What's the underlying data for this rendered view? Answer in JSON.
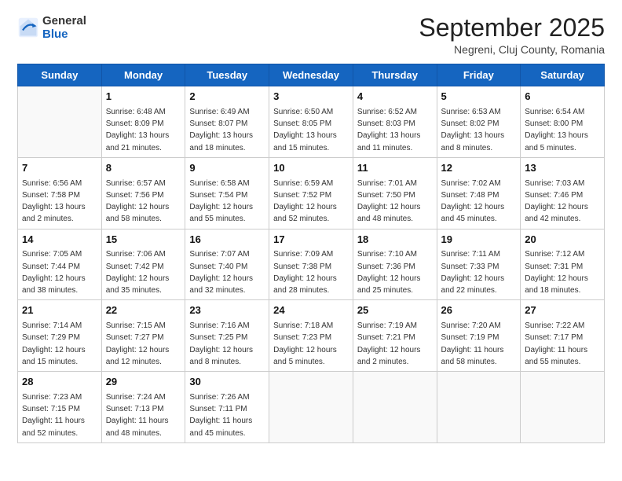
{
  "header": {
    "logo_general": "General",
    "logo_blue": "Blue",
    "month": "September 2025",
    "location": "Negreni, Cluj County, Romania"
  },
  "weekdays": [
    "Sunday",
    "Monday",
    "Tuesday",
    "Wednesday",
    "Thursday",
    "Friday",
    "Saturday"
  ],
  "weeks": [
    [
      {
        "day": "",
        "text": ""
      },
      {
        "day": "1",
        "text": "Sunrise: 6:48 AM\nSunset: 8:09 PM\nDaylight: 13 hours\nand 21 minutes."
      },
      {
        "day": "2",
        "text": "Sunrise: 6:49 AM\nSunset: 8:07 PM\nDaylight: 13 hours\nand 18 minutes."
      },
      {
        "day": "3",
        "text": "Sunrise: 6:50 AM\nSunset: 8:05 PM\nDaylight: 13 hours\nand 15 minutes."
      },
      {
        "day": "4",
        "text": "Sunrise: 6:52 AM\nSunset: 8:03 PM\nDaylight: 13 hours\nand 11 minutes."
      },
      {
        "day": "5",
        "text": "Sunrise: 6:53 AM\nSunset: 8:02 PM\nDaylight: 13 hours\nand 8 minutes."
      },
      {
        "day": "6",
        "text": "Sunrise: 6:54 AM\nSunset: 8:00 PM\nDaylight: 13 hours\nand 5 minutes."
      }
    ],
    [
      {
        "day": "7",
        "text": "Sunrise: 6:56 AM\nSunset: 7:58 PM\nDaylight: 13 hours\nand 2 minutes."
      },
      {
        "day": "8",
        "text": "Sunrise: 6:57 AM\nSunset: 7:56 PM\nDaylight: 12 hours\nand 58 minutes."
      },
      {
        "day": "9",
        "text": "Sunrise: 6:58 AM\nSunset: 7:54 PM\nDaylight: 12 hours\nand 55 minutes."
      },
      {
        "day": "10",
        "text": "Sunrise: 6:59 AM\nSunset: 7:52 PM\nDaylight: 12 hours\nand 52 minutes."
      },
      {
        "day": "11",
        "text": "Sunrise: 7:01 AM\nSunset: 7:50 PM\nDaylight: 12 hours\nand 48 minutes."
      },
      {
        "day": "12",
        "text": "Sunrise: 7:02 AM\nSunset: 7:48 PM\nDaylight: 12 hours\nand 45 minutes."
      },
      {
        "day": "13",
        "text": "Sunrise: 7:03 AM\nSunset: 7:46 PM\nDaylight: 12 hours\nand 42 minutes."
      }
    ],
    [
      {
        "day": "14",
        "text": "Sunrise: 7:05 AM\nSunset: 7:44 PM\nDaylight: 12 hours\nand 38 minutes."
      },
      {
        "day": "15",
        "text": "Sunrise: 7:06 AM\nSunset: 7:42 PM\nDaylight: 12 hours\nand 35 minutes."
      },
      {
        "day": "16",
        "text": "Sunrise: 7:07 AM\nSunset: 7:40 PM\nDaylight: 12 hours\nand 32 minutes."
      },
      {
        "day": "17",
        "text": "Sunrise: 7:09 AM\nSunset: 7:38 PM\nDaylight: 12 hours\nand 28 minutes."
      },
      {
        "day": "18",
        "text": "Sunrise: 7:10 AM\nSunset: 7:36 PM\nDaylight: 12 hours\nand 25 minutes."
      },
      {
        "day": "19",
        "text": "Sunrise: 7:11 AM\nSunset: 7:33 PM\nDaylight: 12 hours\nand 22 minutes."
      },
      {
        "day": "20",
        "text": "Sunrise: 7:12 AM\nSunset: 7:31 PM\nDaylight: 12 hours\nand 18 minutes."
      }
    ],
    [
      {
        "day": "21",
        "text": "Sunrise: 7:14 AM\nSunset: 7:29 PM\nDaylight: 12 hours\nand 15 minutes."
      },
      {
        "day": "22",
        "text": "Sunrise: 7:15 AM\nSunset: 7:27 PM\nDaylight: 12 hours\nand 12 minutes."
      },
      {
        "day": "23",
        "text": "Sunrise: 7:16 AM\nSunset: 7:25 PM\nDaylight: 12 hours\nand 8 minutes."
      },
      {
        "day": "24",
        "text": "Sunrise: 7:18 AM\nSunset: 7:23 PM\nDaylight: 12 hours\nand 5 minutes."
      },
      {
        "day": "25",
        "text": "Sunrise: 7:19 AM\nSunset: 7:21 PM\nDaylight: 12 hours\nand 2 minutes."
      },
      {
        "day": "26",
        "text": "Sunrise: 7:20 AM\nSunset: 7:19 PM\nDaylight: 11 hours\nand 58 minutes."
      },
      {
        "day": "27",
        "text": "Sunrise: 7:22 AM\nSunset: 7:17 PM\nDaylight: 11 hours\nand 55 minutes."
      }
    ],
    [
      {
        "day": "28",
        "text": "Sunrise: 7:23 AM\nSunset: 7:15 PM\nDaylight: 11 hours\nand 52 minutes."
      },
      {
        "day": "29",
        "text": "Sunrise: 7:24 AM\nSunset: 7:13 PM\nDaylight: 11 hours\nand 48 minutes."
      },
      {
        "day": "30",
        "text": "Sunrise: 7:26 AM\nSunset: 7:11 PM\nDaylight: 11 hours\nand 45 minutes."
      },
      {
        "day": "",
        "text": ""
      },
      {
        "day": "",
        "text": ""
      },
      {
        "day": "",
        "text": ""
      },
      {
        "day": "",
        "text": ""
      }
    ]
  ]
}
